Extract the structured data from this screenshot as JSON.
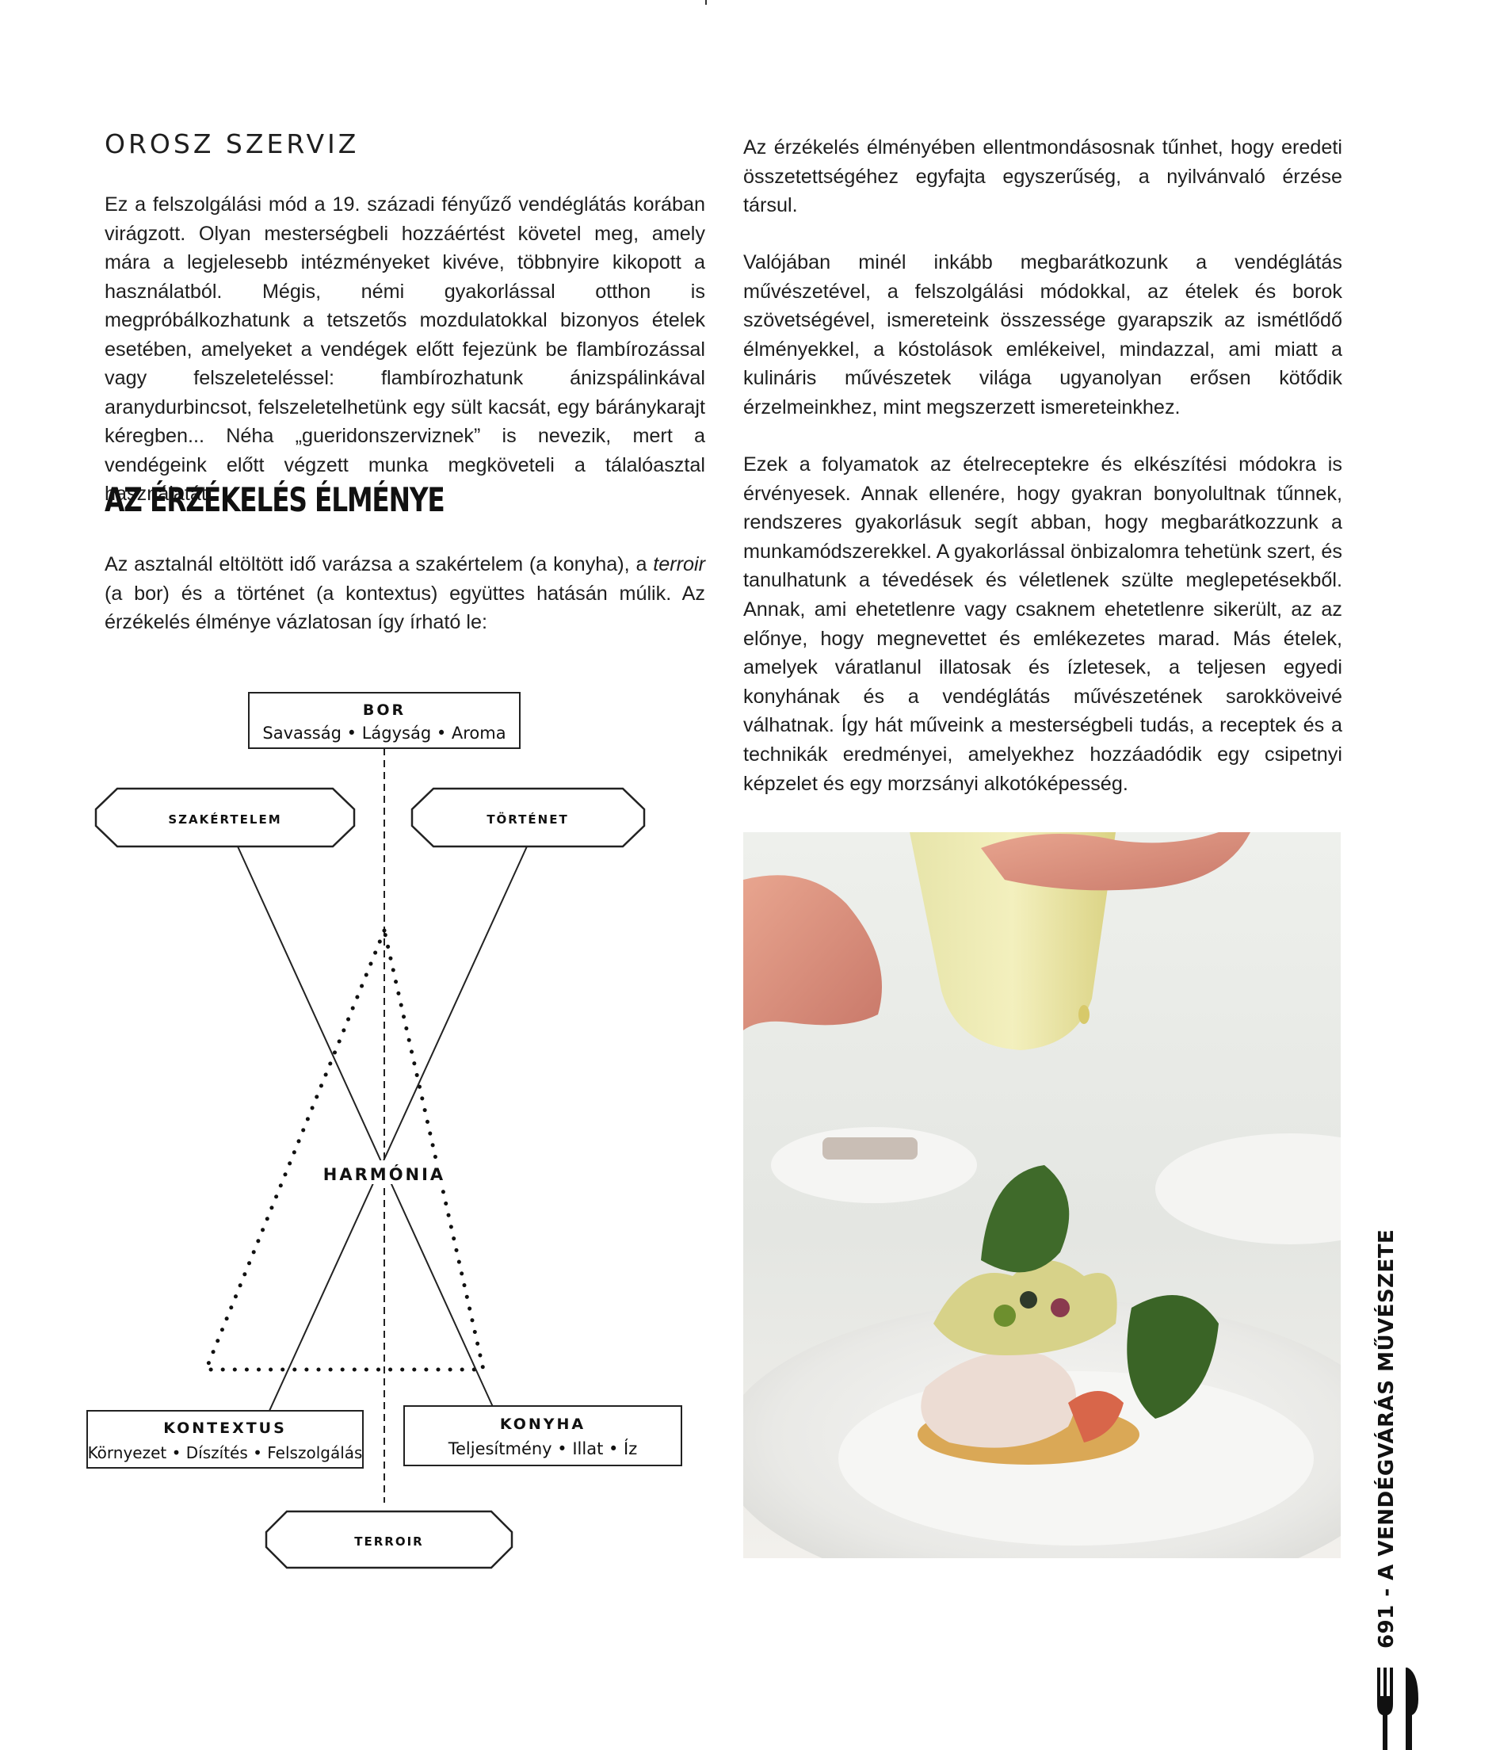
{
  "left_column": {
    "subheading": "OROSZ SZERVIZ",
    "paragraph1": "Ez a felszolgálási mód a 19. századi fényűző vendéglátás korában virágzott. Olyan mesterségbeli hozzáértést követel meg, amely mára a legjelesebb intézményeket kivéve, többnyire kikopott a használatból. Mégis, némi gyakorlással otthon is megpróbálkozhatunk a tetszetős mozdulatokkal bizonyos ételek esetében, amelyeket a vendégek előtt fejezünk be flambírozással vagy felszeleteléssel: flambírozhatunk ánizspálinkával aranydurbincsot, felszeletelhetünk egy sült kacsát, egy báránykarajt kéregben... Néha „gueridonszerviznek” is nevezik, mert a vendégeink előtt végzett munka megköveteli a tálalóasztal használatát.",
    "heading": "AZ ÉRZÉKELÉS ÉLMÉNYE",
    "paragraph2_a": "Az asztalnál eltöltött idő varázsa a szakértelem (a konyha), a ",
    "paragraph2_italic": "terroir",
    "paragraph2_b": " (a bor) és a történet (a kontextus) együttes hatásán múlik. Az érzékelés élménye vázlatosan így írható le:"
  },
  "diagram": {
    "bor_title": "BOR",
    "bor_sub": "Savasság • Lágyság • Aroma",
    "szakertelem": "SZAKÉRTELEM",
    "tortenet": "TÖRTÉNET",
    "harmonia": "HARMÓNIA",
    "kontextus_title": "KONTEXTUS",
    "kontextus_sub": "Környezet • Díszítés • Felszolgálás",
    "konyha_title": "KONYHA",
    "konyha_sub": "Teljesítmény • Illat • Íz",
    "terroir": "TERROIR"
  },
  "right_column": {
    "paragraph1": "Az érzékelés élményében ellentmondásosnak tűnhet, hogy eredeti összetettségéhez egyfajta egyszerűség, a nyilvánvaló érzése társul.",
    "paragraph2": "Valójában minél inkább megbarátkozunk a vendéglátás művészetével, a felszolgálási módokkal, az ételek és borok szövetségével, ismereteink összessége gyarapszik az ismétlődő élményekkel, a kóstolások emlékeivel, mindazzal, ami miatt a kulináris művészetek világa ugyanolyan erősen kötődik érzelmeinkhez, mint megszerzett ismereteinkhez.",
    "paragraph3": "Ezek a folyamatok az ételreceptekre és elkészítési módokra is érvényesek. Annak ellenére, hogy gyakran bonyolultnak tűnnek, rendszeres gyakorlásuk segít abban, hogy megbarátkozzunk a munkamódszerekkel. A gyakorlással önbizalomra tehetünk szert, és tanulhatunk a tévedések és véletlenek szülte meglepetésekből. Annak, ami ehetetlenre vagy csaknem ehetetlenre sikerült, az az előnye, hogy megnevettet és emlékezetes marad. Más ételek, amelyek váratlanul illatosak és ízletesek, a teljesen egyedi konyhának és a vendéglátás művészetének sarokköveivé válhatnak. Így hát műveink a mesterségbeli tudás, a receptek és a technikák eredményei, amelyekhez hozzáadódik egy csipetnyi képzelet és egy morzsányi alkotóképesség."
  },
  "footer": {
    "page_label": "691 - A VENDÉGVÁRÁS MŰVÉSZETE"
  }
}
